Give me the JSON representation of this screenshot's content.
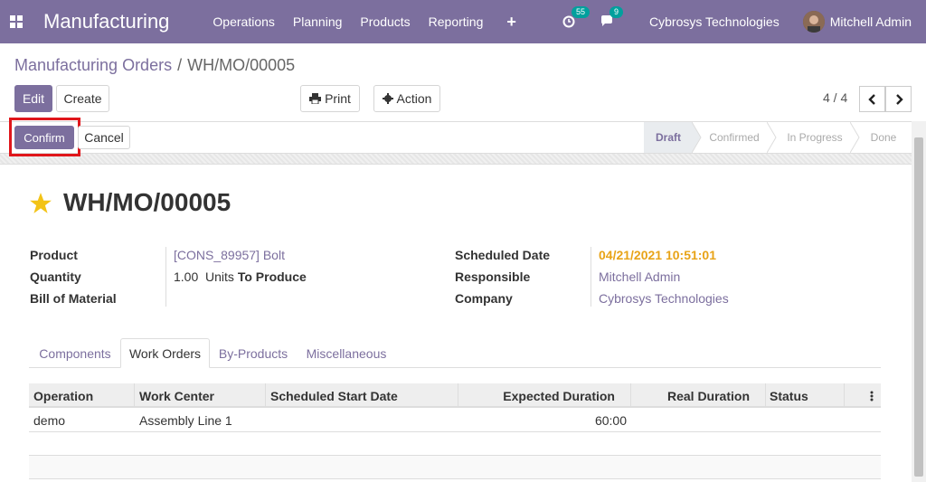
{
  "navbar": {
    "app_title": "Manufacturing",
    "menu": [
      "Operations",
      "Planning",
      "Products",
      "Reporting"
    ],
    "plus": "+",
    "activity_count": "55",
    "message_count": "9",
    "company": "Cybrosys Technologies",
    "user": "Mitchell Admin"
  },
  "breadcrumb": {
    "parent": "Manufacturing Orders",
    "separator": "/",
    "current": "WH/MO/00005"
  },
  "toolbar": {
    "edit": "Edit",
    "create": "Create",
    "print": "Print",
    "action": "Action"
  },
  "pager": {
    "value": "4 / 4"
  },
  "status": {
    "confirm": "Confirm",
    "cancel": "Cancel",
    "stages": [
      "Draft",
      "Confirmed",
      "In Progress",
      "Done"
    ],
    "active_stage": "Draft"
  },
  "record": {
    "title": "WH/MO/00005",
    "left_fields": [
      {
        "label": "Product",
        "value": "[CONS_89957] Bolt"
      },
      {
        "label": "Quantity",
        "value": "1.00",
        "unit": "Units",
        "suffix": "To Produce"
      },
      {
        "label": "Bill of Material",
        "value": ""
      }
    ],
    "right_fields": [
      {
        "label": "Scheduled Date",
        "value": "04/21/2021 10:51:01"
      },
      {
        "label": "Responsible",
        "value": "Mitchell Admin"
      },
      {
        "label": "Company",
        "value": "Cybrosys Technologies"
      }
    ]
  },
  "tabs": [
    "Components",
    "Work Orders",
    "By-Products",
    "Miscellaneous"
  ],
  "active_tab": "Work Orders",
  "table": {
    "columns": [
      "Operation",
      "Work Center",
      "Scheduled Start Date",
      "Expected Duration",
      "Real Duration",
      "Status"
    ],
    "rows": [
      {
        "operation": "demo",
        "work_center": "Assembly Line 1",
        "start": "",
        "expected": "60:00",
        "real": "",
        "status": ""
      }
    ]
  },
  "colors": {
    "brand": "#7c6f9e",
    "highlight": "#e0161b",
    "date": "#e8a317"
  }
}
